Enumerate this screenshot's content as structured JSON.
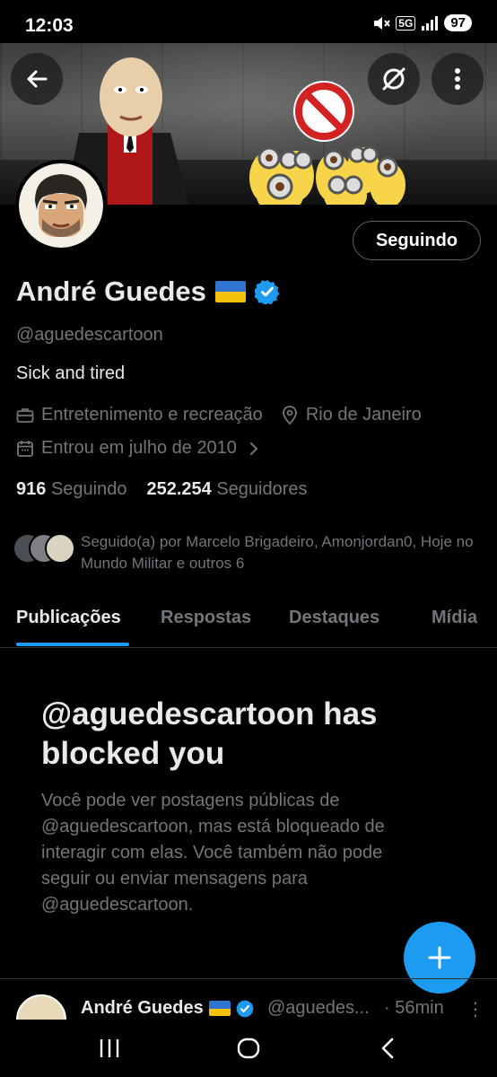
{
  "status_bar": {
    "time": "12:03",
    "network": "5G",
    "battery": "97"
  },
  "profile": {
    "name": "André Guedes",
    "handle": "@aguedescartoon",
    "bio": "Sick and tired",
    "category": "Entretenimento e recreação",
    "location": "Rio de Janeiro",
    "joined": "Entrou em julho de 2010",
    "following_count": "916",
    "following_label": "Seguindo",
    "followers_count": "252.254",
    "followers_label": "Seguidores",
    "follow_button": "Seguindo",
    "followed_by_text": "Seguido(a) por Marcelo Brigadeiro, Amonjordan0, Hoje no Mundo Militar e outros 6"
  },
  "tabs": [
    "Publicações",
    "Respostas",
    "Destaques",
    "Mídia"
  ],
  "blocked": {
    "title": "@aguedescartoon has blocked you",
    "body": "Você pode ver postagens públicas de @aguedescartoon, mas está bloqueado de interagir com elas. Você também não pode seguir ou enviar mensagens para @aguedescartoon."
  },
  "tweet": {
    "name": "André Guedes",
    "handle": "@aguedes...",
    "time": "· 56min",
    "more": "⋮"
  },
  "colors": {
    "accent": "#1d9bf0",
    "background": "#000000",
    "text_primary": "#e7e9ea",
    "text_secondary": "#71767b",
    "divider": "#2f3336"
  },
  "icons": [
    "back-arrow-icon",
    "grok-icon",
    "more-vertical-icon",
    "verified-badge-icon",
    "briefcase-icon",
    "location-pin-icon",
    "calendar-icon",
    "chevron-right-icon",
    "plus-icon",
    "recent-apps-icon",
    "home-icon",
    "back-nav-icon"
  ]
}
